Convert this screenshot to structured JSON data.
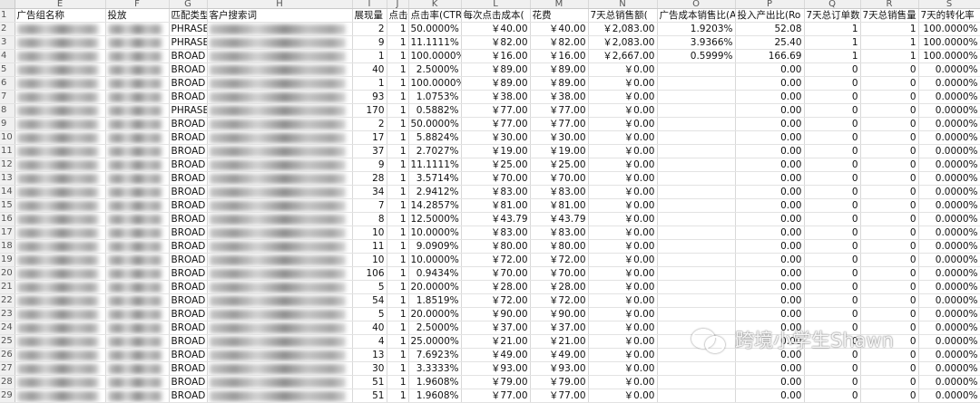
{
  "columns": [
    "E",
    "F",
    "G",
    "H",
    "I",
    "J",
    "K",
    "L",
    "M",
    "N",
    "O",
    "P",
    "Q",
    "R",
    "S"
  ],
  "header": [
    "广告组名称",
    "投放",
    "匹配类型",
    "客户搜索词",
    "展现量",
    "点击",
    "点击率(CTR)",
    "每次点击成本(",
    "花费",
    "7天总销售额(",
    "广告成本销售比(A",
    "投入产出比(Ro",
    "7天总订单数",
    "7天总销售量",
    "7天的转化率"
  ],
  "rows": [
    {
      "n": "2",
      "match": "PHRASE",
      "imp": "2",
      "clk": "1",
      "ctr": "50.0000%",
      "cpc": "￥40.00",
      "spend": "￥40.00",
      "sales": "￥2,083.00",
      "acos": "1.9203%",
      "roas": "52.08",
      "orders": "1",
      "units": "1",
      "conv": "100.0000%"
    },
    {
      "n": "3",
      "match": "PHRASE",
      "imp": "9",
      "clk": "1",
      "ctr": "11.1111%",
      "cpc": "￥82.00",
      "spend": "￥82.00",
      "sales": "￥2,083.00",
      "acos": "3.9366%",
      "roas": "25.40",
      "orders": "1",
      "units": "1",
      "conv": "100.0000%"
    },
    {
      "n": "4",
      "match": "BROAD",
      "imp": "1",
      "clk": "1",
      "ctr": "100.0000%",
      "cpc": "￥16.00",
      "spend": "￥16.00",
      "sales": "￥2,667.00",
      "acos": "0.5999%",
      "roas": "166.69",
      "orders": "1",
      "units": "1",
      "conv": "100.0000%"
    },
    {
      "n": "5",
      "match": "BROAD",
      "imp": "40",
      "clk": "1",
      "ctr": "2.5000%",
      "cpc": "￥89.00",
      "spend": "￥89.00",
      "sales": "￥0.00",
      "acos": "",
      "roas": "0.00",
      "orders": "0",
      "units": "0",
      "conv": "0.0000%"
    },
    {
      "n": "6",
      "match": "BROAD",
      "imp": "1",
      "clk": "1",
      "ctr": "100.0000%",
      "cpc": "￥89.00",
      "spend": "￥89.00",
      "sales": "￥0.00",
      "acos": "",
      "roas": "0.00",
      "orders": "0",
      "units": "0",
      "conv": "0.0000%"
    },
    {
      "n": "7",
      "match": "BROAD",
      "imp": "93",
      "clk": "1",
      "ctr": "1.0753%",
      "cpc": "￥38.00",
      "spend": "￥38.00",
      "sales": "￥0.00",
      "acos": "",
      "roas": "0.00",
      "orders": "0",
      "units": "0",
      "conv": "0.0000%"
    },
    {
      "n": "8",
      "match": "PHRASE",
      "imp": "170",
      "clk": "1",
      "ctr": "0.5882%",
      "cpc": "￥77.00",
      "spend": "￥77.00",
      "sales": "￥0.00",
      "acos": "",
      "roas": "0.00",
      "orders": "0",
      "units": "0",
      "conv": "0.0000%"
    },
    {
      "n": "9",
      "match": "BROAD",
      "imp": "2",
      "clk": "1",
      "ctr": "50.0000%",
      "cpc": "￥77.00",
      "spend": "￥77.00",
      "sales": "￥0.00",
      "acos": "",
      "roas": "0.00",
      "orders": "0",
      "units": "0",
      "conv": "0.0000%"
    },
    {
      "n": "10",
      "match": "BROAD",
      "imp": "17",
      "clk": "1",
      "ctr": "5.8824%",
      "cpc": "￥30.00",
      "spend": "￥30.00",
      "sales": "￥0.00",
      "acos": "",
      "roas": "0.00",
      "orders": "0",
      "units": "0",
      "conv": "0.0000%"
    },
    {
      "n": "11",
      "match": "BROAD",
      "imp": "37",
      "clk": "1",
      "ctr": "2.7027%",
      "cpc": "￥19.00",
      "spend": "￥19.00",
      "sales": "￥0.00",
      "acos": "",
      "roas": "0.00",
      "orders": "0",
      "units": "0",
      "conv": "0.0000%"
    },
    {
      "n": "12",
      "match": "BROAD",
      "imp": "9",
      "clk": "1",
      "ctr": "11.1111%",
      "cpc": "￥25.00",
      "spend": "￥25.00",
      "sales": "￥0.00",
      "acos": "",
      "roas": "0.00",
      "orders": "0",
      "units": "0",
      "conv": "0.0000%"
    },
    {
      "n": "13",
      "match": "BROAD",
      "imp": "28",
      "clk": "1",
      "ctr": "3.5714%",
      "cpc": "￥70.00",
      "spend": "￥70.00",
      "sales": "￥0.00",
      "acos": "",
      "roas": "0.00",
      "orders": "0",
      "units": "0",
      "conv": "0.0000%"
    },
    {
      "n": "14",
      "match": "BROAD",
      "imp": "34",
      "clk": "1",
      "ctr": "2.9412%",
      "cpc": "￥83.00",
      "spend": "￥83.00",
      "sales": "￥0.00",
      "acos": "",
      "roas": "0.00",
      "orders": "0",
      "units": "0",
      "conv": "0.0000%"
    },
    {
      "n": "15",
      "match": "BROAD",
      "imp": "7",
      "clk": "1",
      "ctr": "14.2857%",
      "cpc": "￥81.00",
      "spend": "￥81.00",
      "sales": "￥0.00",
      "acos": "",
      "roas": "0.00",
      "orders": "0",
      "units": "0",
      "conv": "0.0000%"
    },
    {
      "n": "16",
      "match": "BROAD",
      "imp": "8",
      "clk": "1",
      "ctr": "12.5000%",
      "cpc": "￥43.79",
      "spend": "￥43.79",
      "sales": "￥0.00",
      "acos": "",
      "roas": "0.00",
      "orders": "0",
      "units": "0",
      "conv": "0.0000%"
    },
    {
      "n": "17",
      "match": "BROAD",
      "imp": "10",
      "clk": "1",
      "ctr": "10.0000%",
      "cpc": "￥83.00",
      "spend": "￥83.00",
      "sales": "￥0.00",
      "acos": "",
      "roas": "0.00",
      "orders": "0",
      "units": "0",
      "conv": "0.0000%"
    },
    {
      "n": "18",
      "match": "BROAD",
      "imp": "11",
      "clk": "1",
      "ctr": "9.0909%",
      "cpc": "￥80.00",
      "spend": "￥80.00",
      "sales": "￥0.00",
      "acos": "",
      "roas": "0.00",
      "orders": "0",
      "units": "0",
      "conv": "0.0000%"
    },
    {
      "n": "19",
      "match": "BROAD",
      "imp": "10",
      "clk": "1",
      "ctr": "10.0000%",
      "cpc": "￥72.00",
      "spend": "￥72.00",
      "sales": "￥0.00",
      "acos": "",
      "roas": "0.00",
      "orders": "0",
      "units": "0",
      "conv": "0.0000%"
    },
    {
      "n": "20",
      "match": "BROAD",
      "imp": "106",
      "clk": "1",
      "ctr": "0.9434%",
      "cpc": "￥70.00",
      "spend": "￥70.00",
      "sales": "￥0.00",
      "acos": "",
      "roas": "0.00",
      "orders": "0",
      "units": "0",
      "conv": "0.0000%"
    },
    {
      "n": "21",
      "match": "BROAD",
      "imp": "5",
      "clk": "1",
      "ctr": "20.0000%",
      "cpc": "￥28.00",
      "spend": "￥28.00",
      "sales": "￥0.00",
      "acos": "",
      "roas": "0.00",
      "orders": "0",
      "units": "0",
      "conv": "0.0000%"
    },
    {
      "n": "22",
      "match": "BROAD",
      "imp": "54",
      "clk": "1",
      "ctr": "1.8519%",
      "cpc": "￥72.00",
      "spend": "￥72.00",
      "sales": "￥0.00",
      "acos": "",
      "roas": "0.00",
      "orders": "0",
      "units": "0",
      "conv": "0.0000%"
    },
    {
      "n": "23",
      "match": "BROAD",
      "imp": "5",
      "clk": "1",
      "ctr": "20.0000%",
      "cpc": "￥90.00",
      "spend": "￥90.00",
      "sales": "￥0.00",
      "acos": "",
      "roas": "0.00",
      "orders": "0",
      "units": "0",
      "conv": "0.0000%"
    },
    {
      "n": "24",
      "match": "BROAD",
      "imp": "40",
      "clk": "1",
      "ctr": "2.5000%",
      "cpc": "￥37.00",
      "spend": "￥37.00",
      "sales": "￥0.00",
      "acos": "",
      "roas": "0.00",
      "orders": "0",
      "units": "0",
      "conv": "0.0000%"
    },
    {
      "n": "25",
      "match": "BROAD",
      "imp": "4",
      "clk": "1",
      "ctr": "25.0000%",
      "cpc": "￥21.00",
      "spend": "￥21.00",
      "sales": "￥0.00",
      "acos": "",
      "roas": "0.00",
      "orders": "0",
      "units": "0",
      "conv": "0.0000%"
    },
    {
      "n": "26",
      "match": "BROAD",
      "imp": "13",
      "clk": "1",
      "ctr": "7.6923%",
      "cpc": "￥49.00",
      "spend": "￥49.00",
      "sales": "￥0.00",
      "acos": "",
      "roas": "0.00",
      "orders": "0",
      "units": "0",
      "conv": "0.0000%"
    },
    {
      "n": "27",
      "match": "BROAD",
      "imp": "30",
      "clk": "1",
      "ctr": "3.3333%",
      "cpc": "￥93.00",
      "spend": "￥93.00",
      "sales": "￥0.00",
      "acos": "",
      "roas": "0.00",
      "orders": "0",
      "units": "0",
      "conv": "0.0000%"
    },
    {
      "n": "28",
      "match": "BROAD",
      "imp": "51",
      "clk": "1",
      "ctr": "1.9608%",
      "cpc": "￥79.00",
      "spend": "￥79.00",
      "sales": "￥0.00",
      "acos": "",
      "roas": "0.00",
      "orders": "0",
      "units": "0",
      "conv": "0.0000%"
    },
    {
      "n": "29",
      "match": "BROAD",
      "imp": "51",
      "clk": "1",
      "ctr": "1.9608%",
      "cpc": "￥77.00",
      "spend": "￥77.00",
      "sales": "￥0.00",
      "acos": "",
      "roas": "0.00",
      "orders": "0",
      "units": "0",
      "conv": "0.0000%"
    }
  ],
  "watermark": "跨境小学生Shawn",
  "watermark_icon": "wechat-icon"
}
